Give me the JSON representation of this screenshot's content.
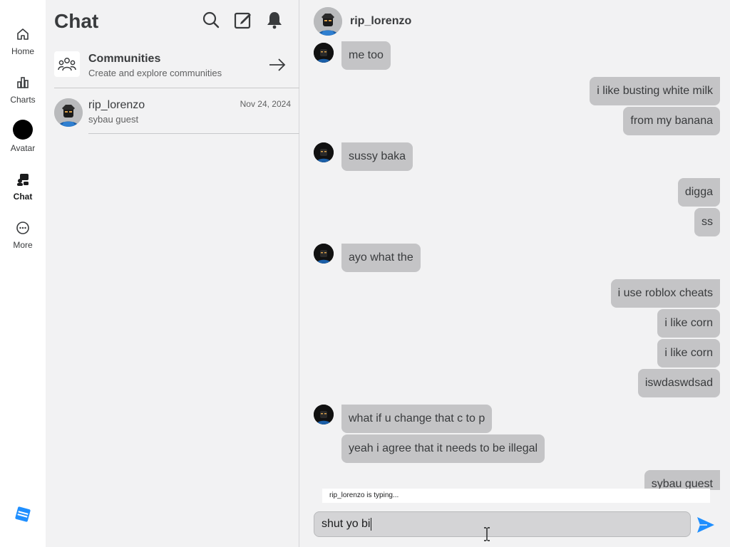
{
  "nav": {
    "items": [
      {
        "label": "Home",
        "icon": "home-icon"
      },
      {
        "label": "Charts",
        "icon": "charts-icon"
      },
      {
        "label": "Avatar",
        "icon": "avatar-icon"
      },
      {
        "label": "Chat",
        "icon": "chat-icon"
      },
      {
        "label": "More",
        "icon": "more-icon"
      }
    ],
    "active": "Chat",
    "logo": "roblox-logo"
  },
  "list": {
    "title": "Chat",
    "header_icons": [
      "search-icon",
      "compose-icon",
      "bell-icon"
    ],
    "communities": {
      "title": "Communities",
      "subtitle": "Create and explore communities"
    },
    "conversations": [
      {
        "name": "rip_lorenzo",
        "date": "Nov 24, 2024",
        "preview": "sybau guest"
      }
    ]
  },
  "conversation": {
    "name": "rip_lorenzo",
    "messages": [
      {
        "from": "them",
        "text": "me too"
      },
      {
        "from": "me",
        "text": "i like busting white milk"
      },
      {
        "from": "me",
        "text": "from my banana"
      },
      {
        "from": "them",
        "text": "sussy baka"
      },
      {
        "from": "me",
        "text": "digga"
      },
      {
        "from": "me",
        "text": "ss"
      },
      {
        "from": "them",
        "text": "ayo what the"
      },
      {
        "from": "me",
        "text": "i use roblox cheats"
      },
      {
        "from": "me",
        "text": "i like corn"
      },
      {
        "from": "me",
        "text": "i like corn"
      },
      {
        "from": "me",
        "text": "iswdaswdsad"
      },
      {
        "from": "them",
        "text": "what if u change that c to p"
      },
      {
        "from": "them",
        "text": "yeah i agree that it needs to be illegal"
      },
      {
        "from": "me",
        "text": "sybau guest"
      }
    ],
    "typing_indicator": "rip_lorenzo is typing...",
    "composer_value": "shut yo bi"
  },
  "colors": {
    "bubble": "#c4c4c6",
    "background": "#f2f2f3",
    "send": "#1f8fff",
    "logo": "#1f8fff"
  }
}
